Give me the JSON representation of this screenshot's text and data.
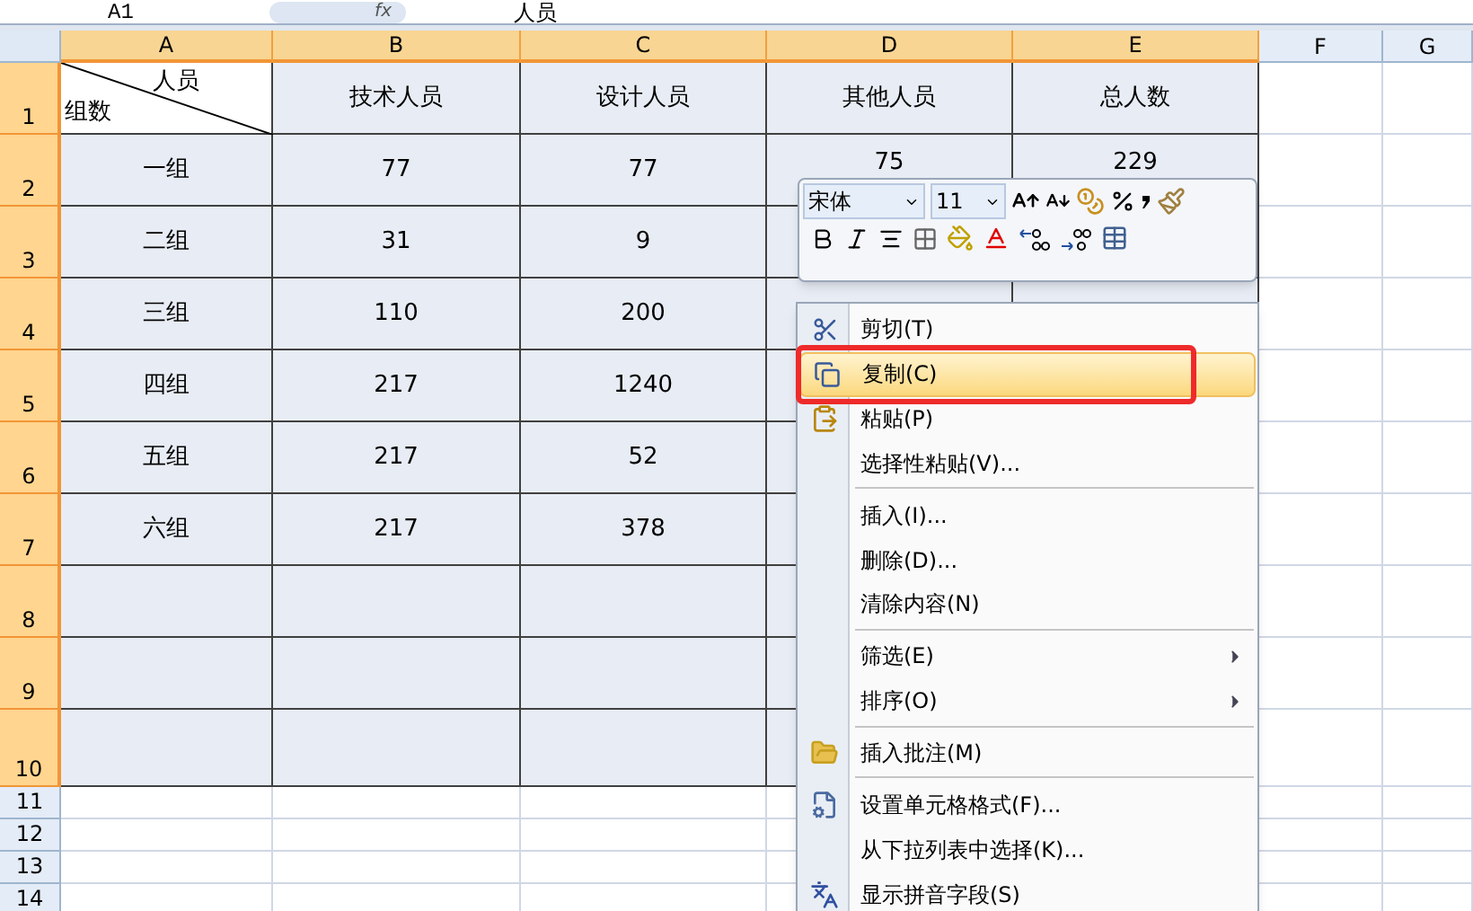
{
  "formula_bar": {
    "name_box": "A1",
    "fx": "fx",
    "value": "人员"
  },
  "columns": [
    {
      "label": "A",
      "selected": true
    },
    {
      "label": "B",
      "selected": true
    },
    {
      "label": "C",
      "selected": true
    },
    {
      "label": "D",
      "selected": true
    },
    {
      "label": "E",
      "selected": true
    },
    {
      "label": "F",
      "selected": false
    },
    {
      "label": "G",
      "selected": false
    }
  ],
  "rows": [
    {
      "header": "1",
      "selected": true,
      "kind": "table",
      "corner": {
        "top": "人员",
        "bottom": "组数"
      },
      "cells": [
        "技术人员",
        "设计人员",
        "其他人员",
        "总人数"
      ]
    },
    {
      "header": "2",
      "selected": true,
      "kind": "table",
      "cells": [
        "一组",
        "77",
        "77",
        "75",
        "229"
      ]
    },
    {
      "header": "3",
      "selected": true,
      "kind": "table",
      "cells": [
        "二组",
        "31",
        "9"
      ]
    },
    {
      "header": "4",
      "selected": true,
      "kind": "table",
      "cells": [
        "三组",
        "110",
        "200"
      ]
    },
    {
      "header": "5",
      "selected": true,
      "kind": "table",
      "cells": [
        "四组",
        "217",
        "1240"
      ]
    },
    {
      "header": "6",
      "selected": true,
      "kind": "table",
      "cells": [
        "五组",
        "217",
        "52"
      ]
    },
    {
      "header": "7",
      "selected": true,
      "kind": "table",
      "cells": [
        "六组",
        "217",
        "378"
      ]
    },
    {
      "header": "8",
      "selected": true,
      "kind": "table"
    },
    {
      "header": "9",
      "selected": true,
      "kind": "table"
    },
    {
      "header": "10",
      "selected": true,
      "kind": "table"
    },
    {
      "header": "11",
      "selected": false,
      "kind": "blank"
    },
    {
      "header": "12",
      "selected": false,
      "kind": "blank"
    },
    {
      "header": "13",
      "selected": false,
      "kind": "blank"
    },
    {
      "header": "14",
      "selected": false,
      "kind": "blank"
    }
  ],
  "mini_toolbar": {
    "font": "宋体",
    "size": "11"
  },
  "context_menu": [
    {
      "kind": "item",
      "label": "剪切(T)",
      "selected": false,
      "submenu": false
    },
    {
      "kind": "item",
      "label": "复制(C)",
      "selected": true,
      "submenu": false
    },
    {
      "kind": "item",
      "label": "粘贴(P)",
      "selected": false,
      "submenu": false
    },
    {
      "kind": "item",
      "label": "选择性粘贴(V)...",
      "selected": false,
      "submenu": false
    },
    {
      "kind": "separator"
    },
    {
      "kind": "item",
      "label": "插入(I)...",
      "selected": false,
      "submenu": false
    },
    {
      "kind": "item",
      "label": "删除(D)...",
      "selected": false,
      "submenu": false
    },
    {
      "kind": "item",
      "label": "清除内容(N)",
      "selected": false,
      "submenu": false
    },
    {
      "kind": "separator"
    },
    {
      "kind": "item",
      "label": "筛选(E)",
      "selected": false,
      "submenu": true
    },
    {
      "kind": "item",
      "label": "排序(O)",
      "selected": false,
      "submenu": true
    },
    {
      "kind": "separator"
    },
    {
      "kind": "item",
      "label": "插入批注(M)",
      "selected": false,
      "submenu": false
    },
    {
      "kind": "separator"
    },
    {
      "kind": "item",
      "label": "设置单元格格式(F)...",
      "selected": false,
      "submenu": false
    },
    {
      "kind": "item",
      "label": "从下拉列表中选择(K)...",
      "selected": false,
      "submenu": false
    },
    {
      "kind": "item",
      "label": "显示拼音字段(S)",
      "selected": false,
      "submenu": false
    }
  ]
}
